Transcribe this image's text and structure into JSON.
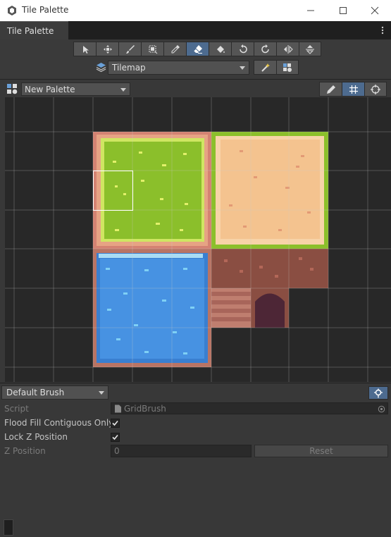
{
  "window": {
    "title": "Tile Palette",
    "minimize_icon": "minimize-icon",
    "maximize_icon": "maximize-icon",
    "close_icon": "close-icon"
  },
  "tab": {
    "label": "Tile Palette"
  },
  "toolbar": {
    "tools": [
      {
        "name": "select-tool",
        "icon": "arrow-pointer-icon",
        "active": false
      },
      {
        "name": "move-tool",
        "icon": "move-arrows-icon",
        "active": false
      },
      {
        "name": "paint-tool",
        "icon": "brush-icon",
        "active": false
      },
      {
        "name": "box-fill-tool",
        "icon": "box-fill-icon",
        "active": false
      },
      {
        "name": "picker-tool",
        "icon": "eyedropper-icon",
        "active": false
      },
      {
        "name": "erase-tool",
        "icon": "eraser-icon",
        "active": true
      },
      {
        "name": "fill-tool",
        "icon": "paint-bucket-icon",
        "active": false
      },
      {
        "name": "rotate-ccw-tool",
        "icon": "rotate-left-icon",
        "active": false
      },
      {
        "name": "rotate-cw-tool",
        "icon": "rotate-right-icon",
        "active": false
      },
      {
        "name": "flip-x-tool",
        "icon": "flip-horizontal-icon",
        "active": false
      },
      {
        "name": "flip-y-tool",
        "icon": "flip-vertical-icon",
        "active": false
      }
    ],
    "active_target": "Tilemap"
  },
  "palette": {
    "selected": "New Palette"
  },
  "brush": {
    "selected": "Default Brush",
    "script_label": "Script",
    "script_value": "GridBrush",
    "flood_fill_label": "Flood Fill Contiguous Only",
    "flood_fill_checked": true,
    "lock_z_label": "Lock Z Position",
    "lock_z_checked": true,
    "z_position_label": "Z Position",
    "z_position_value": "0",
    "reset_label": "Reset"
  },
  "colors": {
    "accent": "#4d6b8f",
    "grass": "#8bbf2b",
    "sand": "#f4c38f",
    "water": "#3f86d8",
    "dirt": "#8a4e42",
    "border": "#d68a7a"
  }
}
